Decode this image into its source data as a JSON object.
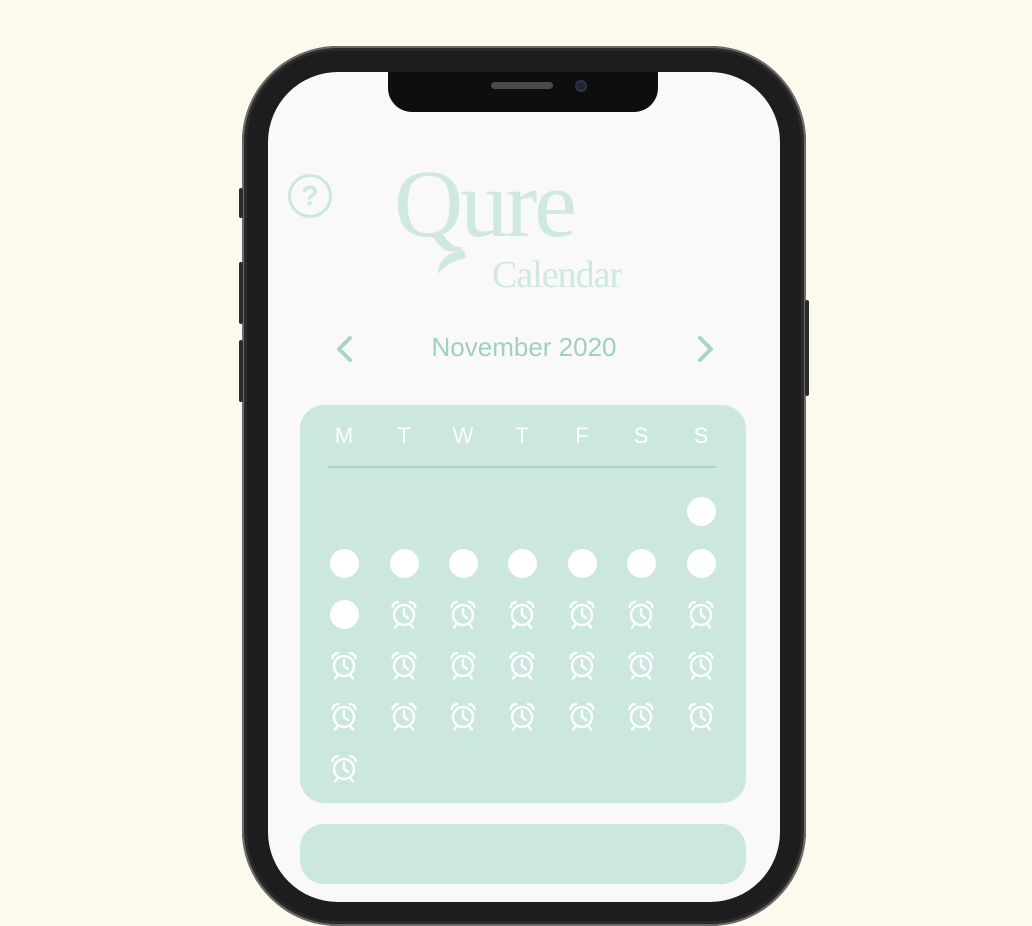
{
  "logo": {
    "title": "Qure",
    "subtitle": "Calendar"
  },
  "help": {
    "label": "?",
    "icon": "question-circle-icon"
  },
  "month_nav": {
    "label": "November 2020",
    "prev_icon": "chevron-left-icon",
    "next_icon": "chevron-right-icon"
  },
  "calendar": {
    "weekdays": [
      "M",
      "T",
      "W",
      "T",
      "F",
      "S",
      "S"
    ],
    "weeks": [
      [
        null,
        null,
        null,
        null,
        null,
        null,
        "dot"
      ],
      [
        "dot",
        "dot",
        "dot",
        "dot",
        "dot",
        "dot",
        "dot"
      ],
      [
        "dot",
        "alarm",
        "alarm",
        "alarm",
        "alarm",
        "alarm",
        "alarm"
      ],
      [
        "alarm",
        "alarm",
        "alarm",
        "alarm",
        "alarm",
        "alarm",
        "alarm"
      ],
      [
        "alarm",
        "alarm",
        "alarm",
        "alarm",
        "alarm",
        "alarm",
        "alarm"
      ],
      [
        "alarm",
        null,
        null,
        null,
        null,
        null,
        null
      ]
    ],
    "cell_icons": {
      "dot": "filled-circle-icon",
      "alarm": "alarm-clock-icon"
    }
  },
  "colors": {
    "background": "#fef9ed",
    "screen": "#f9f9f9",
    "accent": "#cbe7df",
    "accent_text": "#9fd0c2",
    "dot": "#ffffff"
  }
}
